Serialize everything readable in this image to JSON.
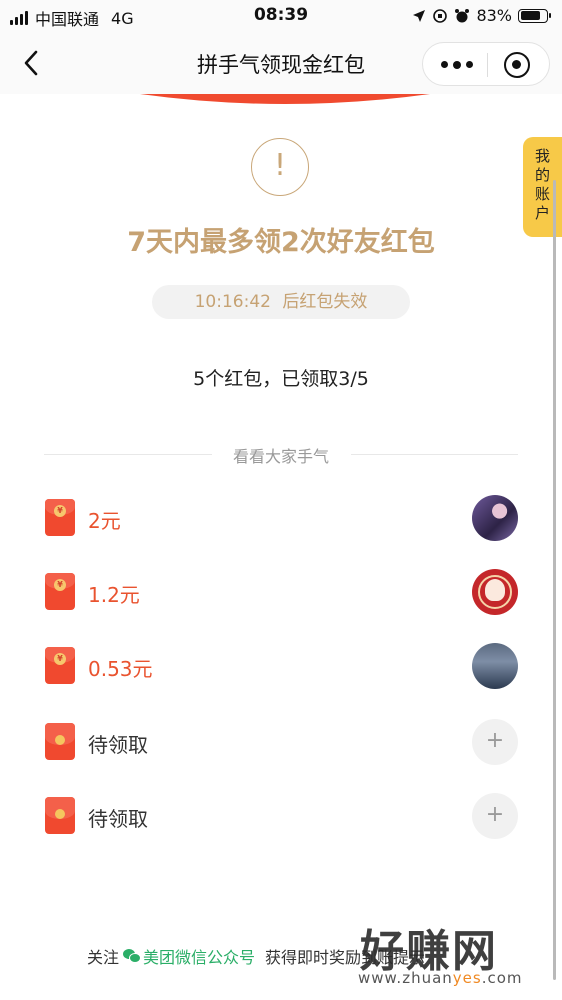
{
  "status_bar": {
    "carrier": "中国联通",
    "network": "4G",
    "time": "08:39",
    "battery_percent": "83%",
    "battery_level": 0.83
  },
  "nav": {
    "title": "拼手气领现金红包"
  },
  "side_tab": {
    "chars": [
      "我",
      "的",
      "账",
      "户"
    ]
  },
  "notice": {
    "icon": "!",
    "headline": "7天内最多领2次好友红包",
    "countdown": "10:16:42",
    "countdown_suffix": "后红包失效",
    "summary": "5个红包，已领取3/5"
  },
  "divider": {
    "label": "看看大家手气"
  },
  "claims": [
    {
      "amount": "2元",
      "avatar": "avatar-1"
    },
    {
      "amount": "1.2元",
      "avatar": "avatar-2"
    },
    {
      "amount": "0.53元",
      "avatar": "avatar-3"
    }
  ],
  "pending": [
    {
      "label": "待领取",
      "button": "+"
    },
    {
      "label": "待领取",
      "button": "+"
    }
  ],
  "footer": {
    "prefix": "关注",
    "link": "美团微信公众号",
    "suffix": "获得即时奖励到账提示"
  },
  "watermark": {
    "main": "好赚网",
    "url_prefix": "www.zhuan",
    "url_highlight": "yes",
    "url_suffix": ".com"
  },
  "colors": {
    "gold": "#c6a273",
    "red": "#e9532f",
    "wechat_green": "#2aae67",
    "side_tab": "#f7c948"
  }
}
